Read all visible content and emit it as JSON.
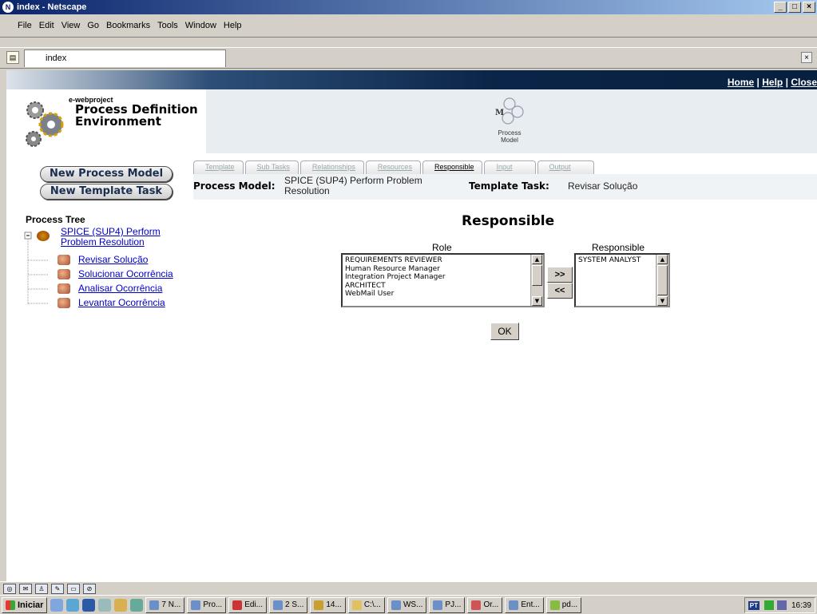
{
  "window": {
    "title": "index - Netscape"
  },
  "window_buttons": {
    "minimize": "_",
    "maximize": "□",
    "close": "×"
  },
  "menu": [
    "File",
    "Edit",
    "View",
    "Go",
    "Bookmarks",
    "Tools",
    "Window",
    "Help"
  ],
  "browser_tab": {
    "label": "index"
  },
  "header": {
    "links": [
      "Home",
      "Help",
      "Close"
    ],
    "separator": "|",
    "brand_small": "e-webproject",
    "brand_line1": "Process Definition",
    "brand_line2": "Environment",
    "process_model_logo_line1": "Process",
    "process_model_logo_line2": "Model"
  },
  "buttons": {
    "new_process_model": "New Process Model",
    "new_template_task": "New Template Task"
  },
  "tabs": [
    {
      "label": "Template",
      "active": false
    },
    {
      "label": "Sub Tasks",
      "active": false
    },
    {
      "label": "Relationships",
      "active": false
    },
    {
      "label": "Resources",
      "active": false
    },
    {
      "label": "Responsible",
      "active": true
    },
    {
      "label": "Input",
      "active": false
    },
    {
      "label": "Output",
      "active": false
    }
  ],
  "info": {
    "process_model_label": "Process Model:",
    "process_model_value_line1": "SPICE (SUP4) Perform Problem",
    "process_model_value_line2": "Resolution",
    "template_task_label": "Template Task:",
    "template_task_value": "Revisar Solução"
  },
  "process_tree": {
    "title": "Process Tree",
    "root_line1": "SPICE (SUP4) Perform",
    "root_line2": "Problem Resolution",
    "children": [
      "Revisar Solução",
      "Solucionar Ocorrência",
      "Analisar Ocorrência",
      "Levantar Ocorrência"
    ]
  },
  "responsible_panel": {
    "heading": "Responsible",
    "role_header": "Role",
    "responsible_header": "Responsible",
    "roles": [
      "REQUIREMENTS REVIEWER",
      "Human Resource Manager",
      "Integration Project Manager",
      "ARCHITECT",
      "WebMail User"
    ],
    "responsibles": [
      "SYSTEM ANALYST"
    ],
    "add_button": ">>",
    "remove_button": "<<",
    "ok_button": "OK"
  },
  "taskbar": {
    "start": "Iniciar",
    "items": [
      "7 N...",
      "Pro...",
      "Edi...",
      "2 S...",
      "14...",
      "C:\\...",
      "WS...",
      "PJ...",
      "Or...",
      "Ent...",
      "pd..."
    ],
    "language": "PT",
    "clock": "16:39"
  },
  "colors": {
    "link": "#0000cc",
    "header_dark": "#0b2548",
    "title_bar": "#0a246a"
  }
}
